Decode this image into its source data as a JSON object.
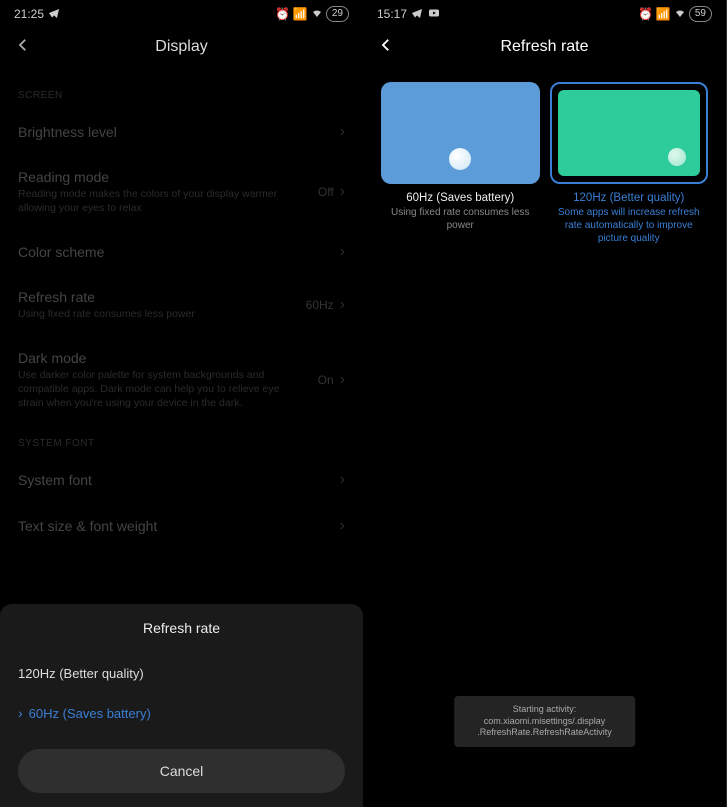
{
  "left": {
    "status": {
      "time": "21:25",
      "battery": "29"
    },
    "header_title": "Display",
    "section_screen": "SCREEN",
    "section_font": "SYSTEM FONT",
    "rows": {
      "brightness": {
        "title": "Brightness level"
      },
      "reading": {
        "title": "Reading mode",
        "sub": "Reading mode makes the colors of your display warmer allowing your eyes to relax",
        "value": "Off"
      },
      "color_scheme": {
        "title": "Color scheme"
      },
      "refresh": {
        "title": "Refresh rate",
        "sub": "Using fixed rate consumes less power",
        "value": "60Hz"
      },
      "dark": {
        "title": "Dark mode",
        "sub": "Use darker color palette for system backgrounds and compatible apps. Dark mode can help you to relieve eye strain when you're using your device in the dark.",
        "value": "On"
      },
      "system_font": {
        "title": "System font"
      },
      "text_size": {
        "title": "Text size & font weight"
      }
    },
    "sheet": {
      "title": "Refresh rate",
      "option_120": "120Hz (Better quality)",
      "option_60": "60Hz (Saves battery)",
      "cancel": "Cancel"
    }
  },
  "right": {
    "status": {
      "time": "15:17",
      "battery": "59"
    },
    "header_title": "Refresh rate",
    "card_60": {
      "title": "60Hz (Saves battery)",
      "sub": "Using fixed rate consumes less power"
    },
    "card_120": {
      "title": "120Hz (Better quality)",
      "sub": "Some apps will increase refresh rate automatically to improve picture quality"
    },
    "toast": "Starting activity: com.xiaomi.misettings/.display\n.RefreshRate.RefreshRateActivity"
  }
}
